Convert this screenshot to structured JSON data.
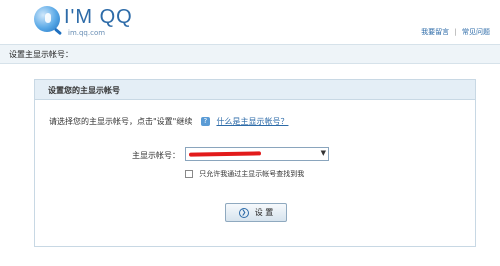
{
  "header": {
    "logo_text": "I'M QQ",
    "logo_sub": "im.qq.com",
    "links": [
      "我要留言",
      "常见问题"
    ],
    "link_sep": "|"
  },
  "titlebar": {
    "text": "设置主显示帐号："
  },
  "panel": {
    "title": "设置您的主显示帐号",
    "description": "请选择您的主显示帐号，点击\"设置\"继续",
    "help_icon_glyph": "?",
    "help_link": "什么是主显示帐号？",
    "field_label": "主显示帐号：",
    "select_arrow": "▼",
    "checkbox_label": "只允许我通过主显示帐号查找到我",
    "button_icon_glyph": "❯",
    "button_label": "设 置"
  },
  "colors": {
    "accent": "#2d6ba8",
    "redacted": "#e21a1a",
    "header_bar": "#eef4f8"
  }
}
